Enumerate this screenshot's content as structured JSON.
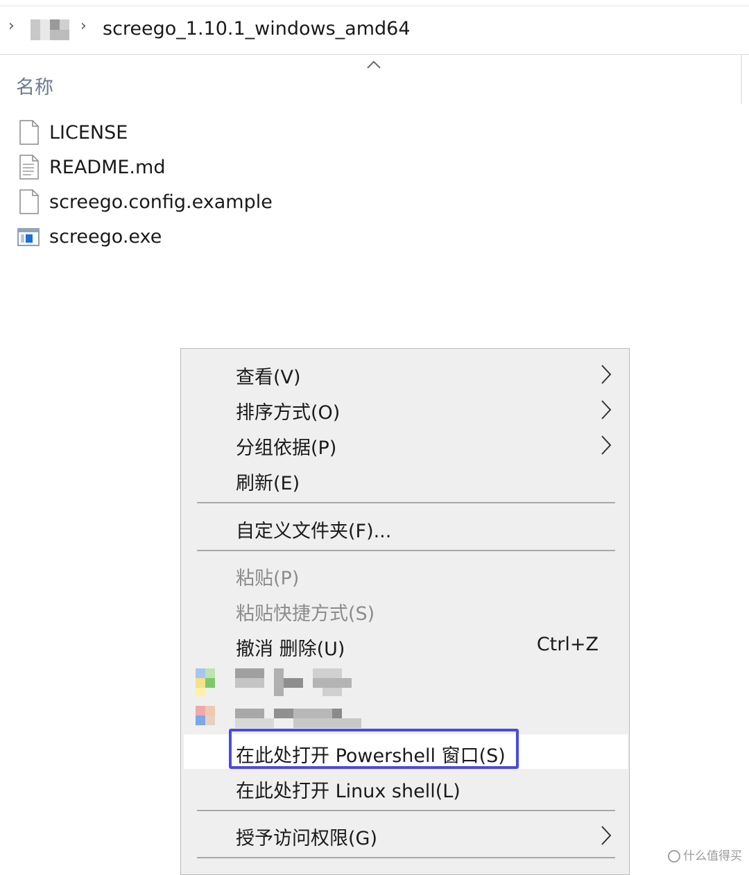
{
  "address_bar": {
    "folder": "screego_1.10.1_windows_amd64"
  },
  "column_header": {
    "name": "名称"
  },
  "files": [
    {
      "name": "LICENSE",
      "icon": "blank-file-icon"
    },
    {
      "name": "README.md",
      "icon": "text-file-icon"
    },
    {
      "name": "screego.config.example",
      "icon": "blank-file-icon"
    },
    {
      "name": "screego.exe",
      "icon": "exe-file-icon"
    }
  ],
  "context_menu": {
    "items": [
      {
        "label": "查看(V)",
        "submenu": true
      },
      {
        "label": "排序方式(O)",
        "submenu": true
      },
      {
        "label": "分组依据(P)",
        "submenu": true
      },
      {
        "label": "刷新(E)"
      },
      {
        "label": "自定义文件夹(F)..."
      },
      {
        "label": "粘贴(P)",
        "disabled": true
      },
      {
        "label": "粘贴快捷方式(S)",
        "disabled": true
      },
      {
        "label": "撤消 删除(U)",
        "shortcut": "Ctrl+Z"
      },
      {
        "label": "在此处打开 Powershell 窗口(S)",
        "highlighted": true
      },
      {
        "label": "在此处打开 Linux shell(L)"
      },
      {
        "label": "授予访问权限(G)",
        "submenu": true
      }
    ]
  },
  "watermark": "什么值得买",
  "colors": {
    "highlight_border": "#4a4ae0",
    "menu_bg": "#efefef",
    "disabled_text": "#8c8c8c",
    "header_text": "#6a7a8c"
  }
}
